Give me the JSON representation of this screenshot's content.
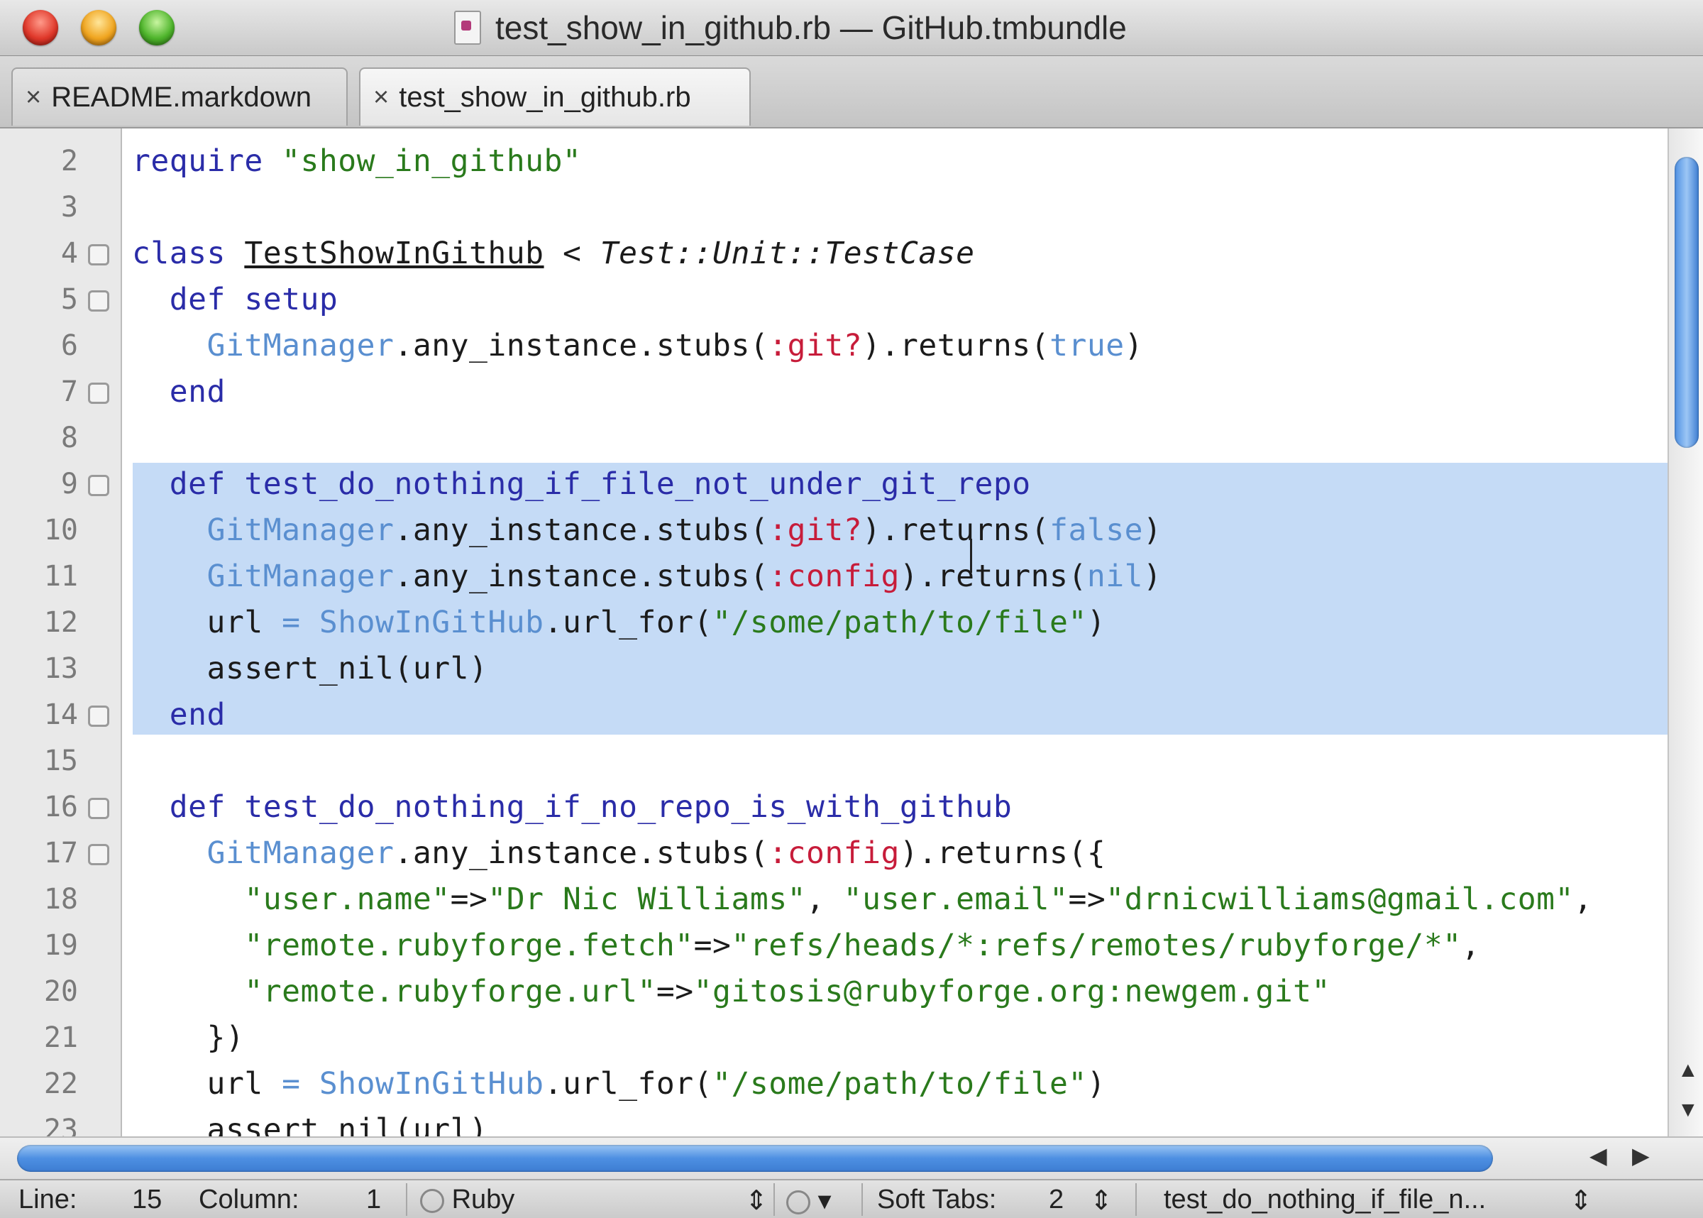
{
  "window": {
    "title": "test_show_in_github.rb — GitHub.tmbundle"
  },
  "tabs": [
    {
      "label": "README.markdown",
      "close": "×"
    },
    {
      "label": "test_show_in_github.rb",
      "close": "×"
    }
  ],
  "gutter": {
    "line_numbers": [
      "2",
      "3",
      "4",
      "5",
      "6",
      "7",
      "8",
      "9",
      "10",
      "11",
      "12",
      "13",
      "14",
      "15",
      "16",
      "17",
      "18",
      "19",
      "20",
      "21",
      "22",
      "23"
    ]
  },
  "code": {
    "l2_a": "require ",
    "l2_b": "\"show_in_github\"",
    "l4_a": "class ",
    "l4_b": "TestShowInGithub",
    "l4_c": " < ",
    "l4_d": "Test::Unit::TestCase",
    "l5_a": "  def ",
    "l5_b": "setup",
    "l6_a": "    ",
    "l6_b": "GitManager",
    "l6_c": ".any_instance.stubs(",
    "l6_d": ":git?",
    "l6_e": ").returns(",
    "l6_f": "true",
    "l6_g": ")",
    "l7": "  end",
    "l9_a": "  def ",
    "l9_b": "test_do_nothing_if_file_not_under_git_repo",
    "l10_a": "    ",
    "l10_b": "GitManager",
    "l10_c": ".any_instance.stubs(",
    "l10_d": ":git?",
    "l10_e": ").returns(",
    "l10_f": "false",
    "l10_g": ")",
    "l11_a": "    ",
    "l11_b": "GitManager",
    "l11_c": ".any_instance.stubs(",
    "l11_d": ":config",
    "l11_e": ").returns(",
    "l11_f": "nil",
    "l11_g": ")",
    "l12_a": "    url ",
    "l12_b": "=",
    "l12_c": " ",
    "l12_d": "ShowInGitHub",
    "l12_e": ".url_for(",
    "l12_f": "\"/some/path/to/file\"",
    "l12_g": ")",
    "l13": "    assert_nil(url)",
    "l14": "  end",
    "l16_a": "  def ",
    "l16_b": "test_do_nothing_if_no_repo_is_with_github",
    "l17_a": "    ",
    "l17_b": "GitManager",
    "l17_c": ".any_instance.stubs(",
    "l17_d": ":config",
    "l17_e": ").returns({",
    "l18_a": "      ",
    "l18_b": "\"user.name\"",
    "l18_c": "=>",
    "l18_d": "\"Dr Nic Williams\"",
    "l18_e": ", ",
    "l18_f": "\"user.email\"",
    "l18_g": "=>",
    "l18_h": "\"drnicwilliams@gmail.com\"",
    "l18_i": ",",
    "l19_a": "      ",
    "l19_b": "\"remote.rubyforge.fetch\"",
    "l19_c": "=>",
    "l19_d": "\"refs/heads/*:refs/remotes/rubyforge/*\"",
    "l19_e": ",",
    "l20_a": "      ",
    "l20_b": "\"remote.rubyforge.url\"",
    "l20_c": "=>",
    "l20_d": "\"gitosis@rubyforge.org:newgem.git\"",
    "l21": "    })",
    "l22_a": "    url ",
    "l22_b": "=",
    "l22_c": " ",
    "l22_d": "ShowInGitHub",
    "l22_e": ".url_for(",
    "l22_f": "\"/some/path/to/file\"",
    "l22_g": ")",
    "l23": "    assert_nil(url)"
  },
  "status": {
    "line_label": "Line:",
    "line_value": "15",
    "column_label": "Column:",
    "column_value": "1",
    "language": "Ruby",
    "soft_tabs_label": "Soft Tabs:",
    "soft_tabs_value": "2",
    "symbol": "test_do_nothing_if_file_n..."
  },
  "colors": {
    "keyword": "#2a2ca8",
    "string": "#2a7a1c",
    "symbol": "#c71c3a",
    "constant": "#5a8fd0",
    "selection": "#c5dbf6"
  }
}
